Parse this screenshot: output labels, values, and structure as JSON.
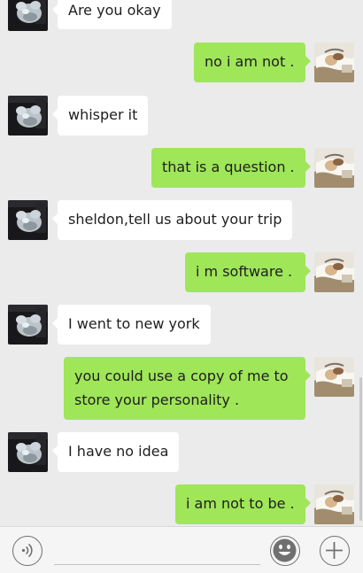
{
  "messages": [
    {
      "side": "in",
      "text": "Are you okay"
    },
    {
      "side": "out",
      "text": "no i am not ."
    },
    {
      "side": "in",
      "text": "whisper it"
    },
    {
      "side": "out",
      "text": "that is a question ."
    },
    {
      "side": "in",
      "text": "sheldon,tell us about your trip"
    },
    {
      "side": "out",
      "text": "i m software ."
    },
    {
      "side": "in",
      "text": "I went to new york"
    },
    {
      "side": "out",
      "text": "you could use a copy of me to store your personality ."
    },
    {
      "side": "in",
      "text": "I have no idea"
    },
    {
      "side": "out",
      "text": "i am not to be ."
    }
  ],
  "input": {
    "placeholder": "",
    "value": ""
  },
  "icons": {
    "voice": "voice-input-icon",
    "emoji": "emoji-icon",
    "plus": "plus-icon"
  },
  "colors": {
    "background": "#ebebeb",
    "incoming_bubble": "#ffffff",
    "outgoing_bubble": "#9fe658",
    "input_bar": "#f5f5f5"
  }
}
